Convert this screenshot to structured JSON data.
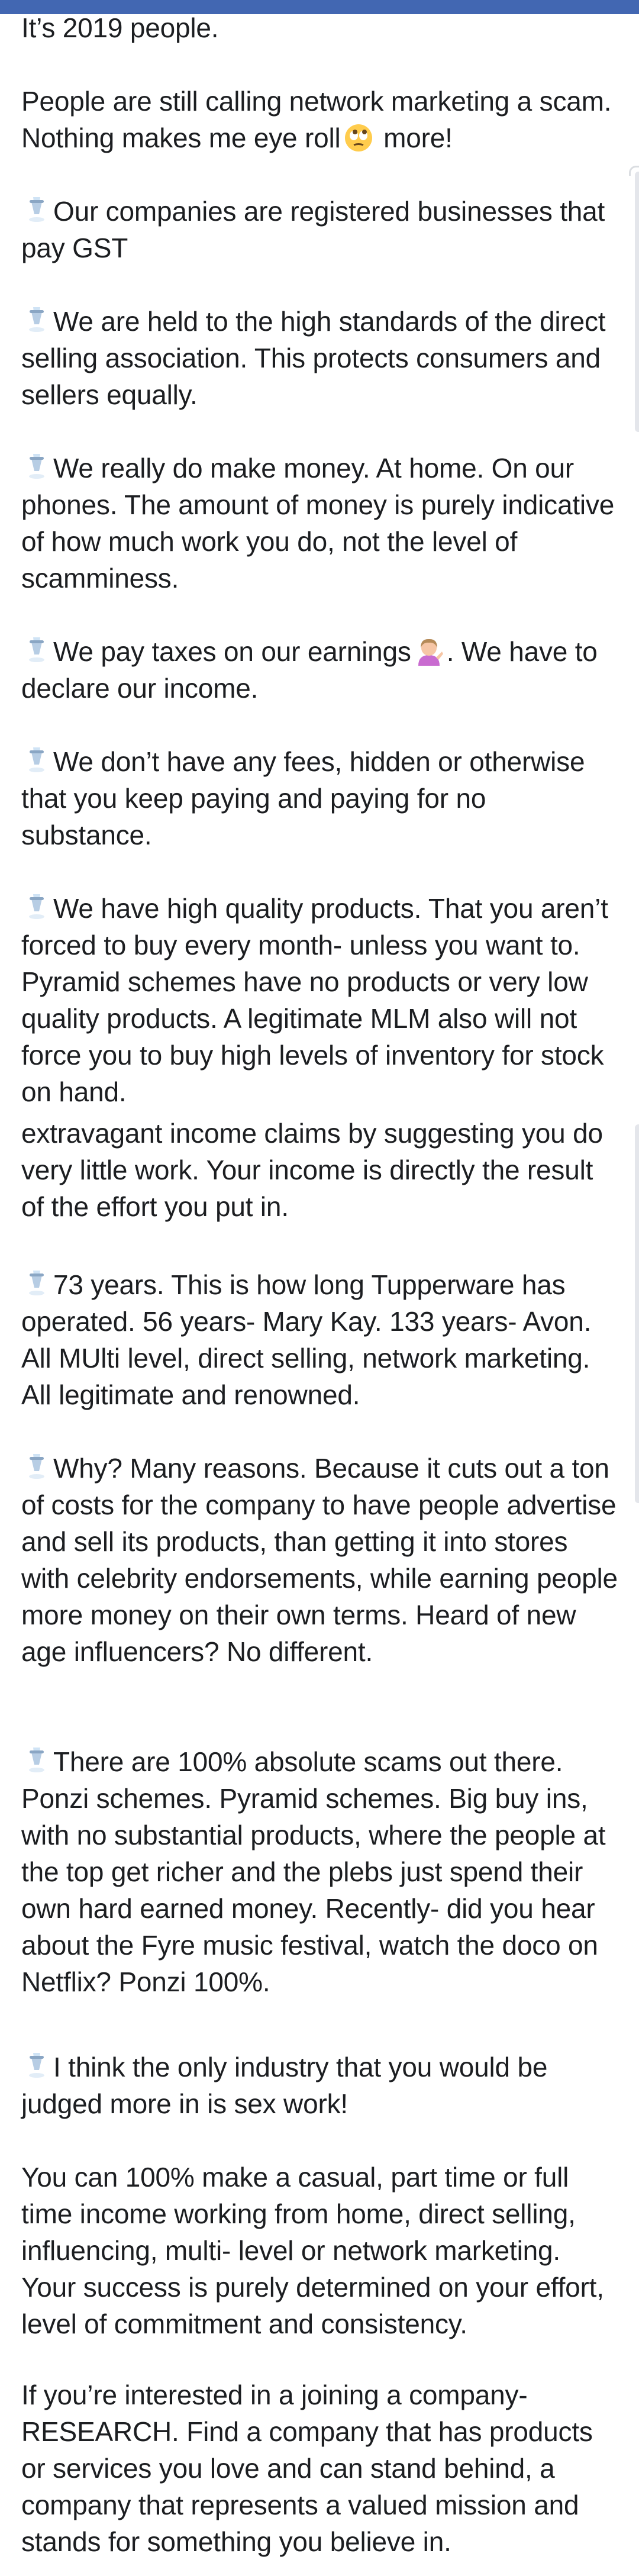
{
  "post": {
    "paragraphs": [
      {
        "icon": null,
        "text": "It’s 2019 people."
      },
      {
        "icon": null,
        "text": "People are still calling network marketing a scam. Nothing makes me eye roll",
        "emoji": "eye-roll-emoji",
        "tail": " more!"
      },
      {
        "icon": "flying-saucer-icon",
        "text": "Our companies are registered businesses that pay GST"
      },
      {
        "icon": "flying-saucer-icon",
        "text": "We are held to the high standards of the direct selling association. This protects consumers and sellers equally."
      },
      {
        "icon": "flying-saucer-icon",
        "text": "We really do make money. At home. On our phones. The amount of money is purely indicative of how much work you do, not the level of scamminess."
      },
      {
        "icon": "flying-saucer-icon",
        "text": "We pay taxes on our earnings",
        "emoji": "tipping-hand-emoji",
        "tail": ". We have to declare our income."
      },
      {
        "icon": "flying-saucer-icon",
        "text": "We don’t have any fees, hidden or otherwise that you keep paying and paying for no substance."
      },
      {
        "icon": "flying-saucer-icon",
        "text": "We have high quality products. That you aren’t forced to buy every month- unless you want to. Pyramid schemes have no products or very low quality products. A legitimate MLM also will not force you to buy high levels of inventory for stock on hand."
      },
      {
        "icon": null,
        "text": "extravagant income claims by suggesting you do very little work. Your income is directly the result of the effort you put in."
      },
      {
        "icon": "flying-saucer-icon",
        "text": "73 years. This is how long Tupperware has operated. 56 years- Mary Kay. 133 years- Avon. All MUlti level, direct selling, network marketing. All legitimate and renowned."
      },
      {
        "icon": "flying-saucer-icon",
        "text": "Why? Many reasons. Because it cuts out a ton of costs for the company to have people advertise and sell its products, than getting it into stores with celebrity endorsements, while earning people more money on their own terms. Heard of new age influencers? No different."
      },
      {
        "icon": "flying-saucer-icon",
        "text": "There are 100% absolute scams out there. Ponzi schemes. Pyramid schemes. Big buy ins, with no substantial products, where the people at the top get richer and the plebs just spend their own hard earned money. Recently- did you hear about the Fyre music festival, watch the doco on Netflix? Ponzi 100%."
      },
      {
        "icon": "flying-saucer-icon",
        "text": "I think the only industry that you would be judged more in is sex work!"
      },
      {
        "icon": null,
        "text": "You can 100% make a casual, part time or full time income working from home, direct selling, influencing, multi- level or network marketing. Your success is purely determined on your effort, level of commitment and consistency."
      },
      {
        "icon": null,
        "text": "If you’re interested in a joining a company- RESEARCH. Find a company that has products or services you love and can stand behind, a company that represents a valued mission and stands for something you believe in."
      }
    ]
  },
  "colors": {
    "header": "#4267b2",
    "text": "#1c1e21",
    "edge": "#e4e6eb"
  }
}
